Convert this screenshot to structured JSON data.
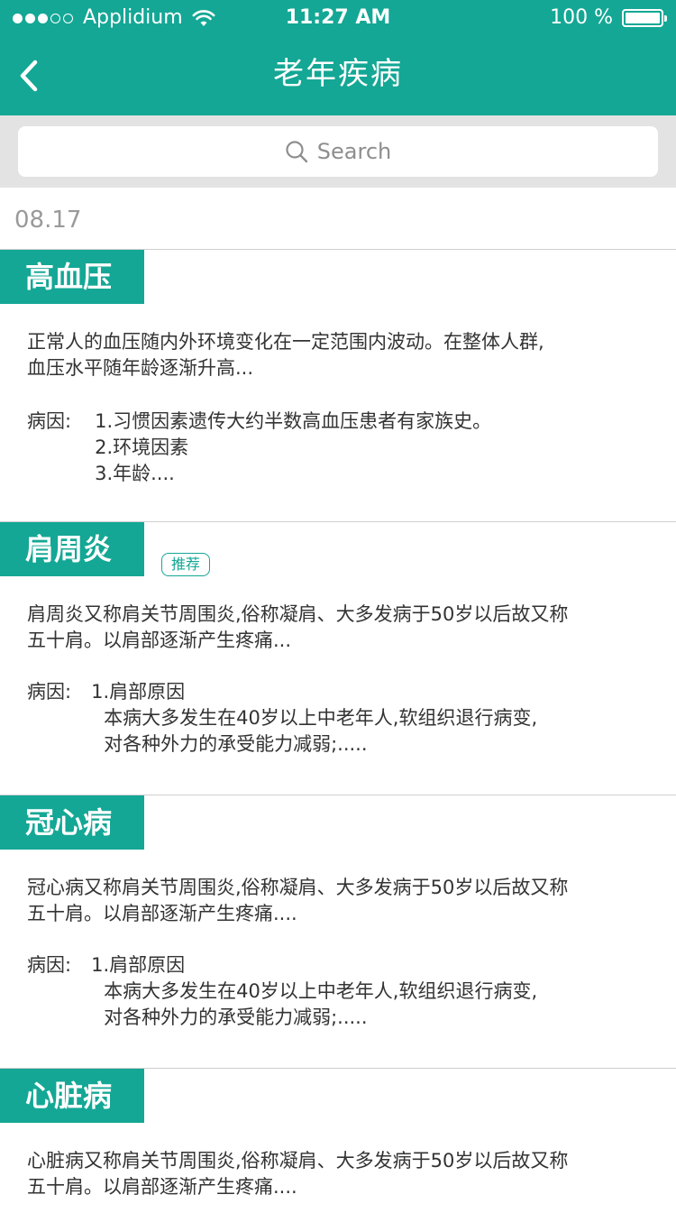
{
  "status_bar": {
    "carrier": "Applidium",
    "time": "11:27 AM",
    "battery": "100 %"
  },
  "nav": {
    "back_icon": "chevron-left-icon",
    "title": "老年疾病"
  },
  "search": {
    "placeholder": "Search",
    "icon": "search-icon"
  },
  "date": "08.17",
  "diseases": [
    {
      "name": "高血压",
      "desc": [
        "正常人的血压随内外环境变化在一定范围内波动。在整体人群,",
        "血压水平随年龄逐渐升高..."
      ],
      "cause_label": "病因:",
      "causes": [
        "1.习惯因素遗传大约半数高血压患者有家族史。",
        "2.环境因素",
        "3.年龄...."
      ]
    },
    {
      "name": "肩周炎",
      "badge": "推荐",
      "desc": [
        "肩周炎又称肩关节周围炎,俗称凝肩、大多发病于50岁以后故又称",
        "五十肩。以肩部逐渐产生疼痛..."
      ],
      "cause_label": "病因:",
      "causes": [
        "1.肩部原因",
        "本病大多发生在40岁以上中老年人,软组织退行病变,",
        "对各种外力的承受能力减弱;....."
      ]
    },
    {
      "name": "冠心病",
      "desc": [
        "冠心病又称肩关节周围炎,俗称凝肩、大多发病于50岁以后故又称",
        "五十肩。以肩部逐渐产生疼痛...."
      ],
      "cause_label": "病因:",
      "causes": [
        "1.肩部原因",
        "本病大多发生在40岁以上中老年人,软组织退行病变,",
        "对各种外力的承受能力减弱;....."
      ]
    },
    {
      "name": "心脏病",
      "desc": [
        "心脏病又称肩关节周围炎,俗称凝肩、大多发病于50岁以后故又称",
        "五十肩。以肩部逐渐产生疼痛...."
      ]
    }
  ],
  "colors": {
    "brand": "#14a795",
    "search_bg": "#e3e3e3",
    "date_text": "#9a9a9a"
  }
}
